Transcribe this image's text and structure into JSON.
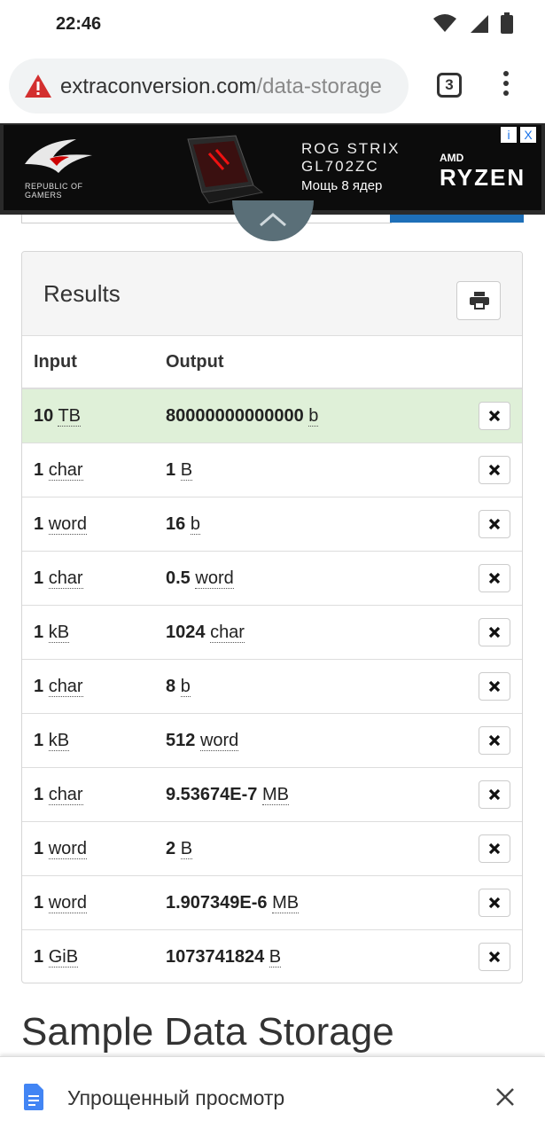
{
  "status": {
    "time": "22:46"
  },
  "browser": {
    "url_domain": "extraconversion.com",
    "url_path": "/data-storage",
    "tab_count": "3"
  },
  "ad": {
    "brand_line1": "REPUBLIC OF",
    "brand_line2": "GAMERS",
    "product_line1": "ROG STRIX",
    "product_line2": "GL702ZC",
    "tagline": "Мощь 8 ядер",
    "cpu_brand": "AMD",
    "cpu_name": "RYZEN",
    "info_icon": "i",
    "close_icon": "X"
  },
  "results": {
    "title": "Results",
    "headers": {
      "input": "Input",
      "output": "Output"
    },
    "rows": [
      {
        "in_num": "10",
        "in_unit": "TB",
        "out_num": "80000000000000",
        "out_unit": "b"
      },
      {
        "in_num": "1",
        "in_unit": "char",
        "out_num": "1",
        "out_unit": "B"
      },
      {
        "in_num": "1",
        "in_unit": "word",
        "out_num": "16",
        "out_unit": "b"
      },
      {
        "in_num": "1",
        "in_unit": "char",
        "out_num": "0.5",
        "out_unit": "word"
      },
      {
        "in_num": "1",
        "in_unit": "kB",
        "out_num": "1024",
        "out_unit": "char"
      },
      {
        "in_num": "1",
        "in_unit": "char",
        "out_num": "8",
        "out_unit": "b"
      },
      {
        "in_num": "1",
        "in_unit": "kB",
        "out_num": "512",
        "out_unit": "word"
      },
      {
        "in_num": "1",
        "in_unit": "char",
        "out_num": "9.53674E-7",
        "out_unit": "MB"
      },
      {
        "in_num": "1",
        "in_unit": "word",
        "out_num": "2",
        "out_unit": "B"
      },
      {
        "in_num": "1",
        "in_unit": "word",
        "out_num": "1.907349E-6",
        "out_unit": "MB"
      },
      {
        "in_num": "1",
        "in_unit": "GiB",
        "out_num": "1073741824",
        "out_unit": "B"
      }
    ]
  },
  "section_heading": "Sample Data Storage",
  "bottom_bar": {
    "label": "Упрощенный просмотр"
  },
  "colors": {
    "highlight_row": "#dff0d8",
    "warning_red": "#d32f2f",
    "button_blue": "#1e6fb8"
  }
}
